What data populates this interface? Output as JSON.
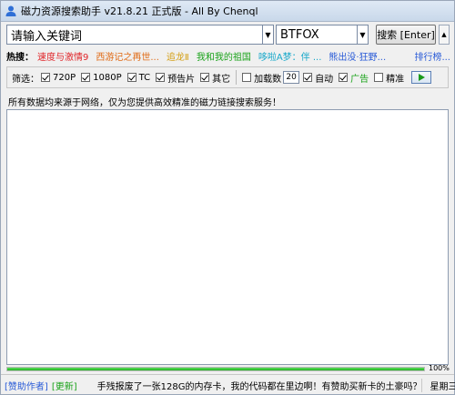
{
  "window": {
    "title": "磁力资源搜索助手 v21.8.21 正式版 - All By Chenql"
  },
  "search": {
    "keyword_value": "请输入关键词",
    "site_value": "BTFOX",
    "search_button_label": "搜索 [Enter]"
  },
  "hot": {
    "label": "热搜：",
    "items": [
      {
        "text": "速度与激情9",
        "color": "#e0262a"
      },
      {
        "text": "西游记之再世...",
        "color": "#e06b17"
      },
      {
        "text": "追龙Ⅱ",
        "color": "#d4a017"
      },
      {
        "text": "我和我的祖国",
        "color": "#1aa21a"
      },
      {
        "text": "哆啦A梦：伴 ...",
        "color": "#16a7c9"
      },
      {
        "text": "熊出没·狂野...",
        "color": "#2a5bd7"
      }
    ],
    "more_label": "排行榜..."
  },
  "filters": {
    "label": "筛选：",
    "types": [
      {
        "label": "720P",
        "checked": true
      },
      {
        "label": "1080P",
        "checked": true
      },
      {
        "label": "TC",
        "checked": true
      },
      {
        "label": "预告片",
        "checked": true
      },
      {
        "label": "其它",
        "checked": true
      }
    ],
    "load_count_label": "加载数",
    "load_count_checked": false,
    "load_count_value": "20",
    "auto_label": "自动",
    "auto_checked": true,
    "ad_label": "广告",
    "ad_checked": true,
    "exact_label": "精准",
    "exact_checked": false
  },
  "info_text": "所有数据均来源于网络，仅为您提供高效精准的磁力链接搜索服务！",
  "progress": {
    "percent": 100,
    "label": "100%"
  },
  "status": {
    "donate_label": "[赞助作者]",
    "update_label": "[更新]",
    "marquee_text": "手残报废了一张128G的内存卡，我的代码都在里边啊！有赞助买新卡的土豪吗？",
    "weekday": "星期三"
  }
}
